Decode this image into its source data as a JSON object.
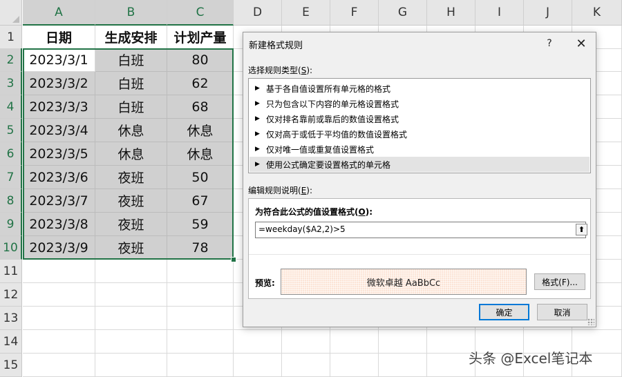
{
  "columns": [
    "A",
    "B",
    "C",
    "D",
    "E",
    "F",
    "G",
    "H",
    "I",
    "J",
    "K"
  ],
  "rows": [
    "1",
    "2",
    "3",
    "4",
    "5",
    "6",
    "7",
    "8",
    "9",
    "10",
    "11",
    "12",
    "13",
    "14",
    "15"
  ],
  "table": {
    "headers": [
      "日期",
      "生成安排",
      "计划产量"
    ],
    "data": [
      [
        "2023/3/1",
        "白班",
        "80"
      ],
      [
        "2023/3/2",
        "白班",
        "62"
      ],
      [
        "2023/3/3",
        "白班",
        "68"
      ],
      [
        "2023/3/4",
        "休息",
        "休息"
      ],
      [
        "2023/3/5",
        "休息",
        "休息"
      ],
      [
        "2023/3/6",
        "夜班",
        "50"
      ],
      [
        "2023/3/7",
        "夜班",
        "67"
      ],
      [
        "2023/3/8",
        "夜班",
        "59"
      ],
      [
        "2023/3/9",
        "夜班",
        "78"
      ]
    ]
  },
  "dialog": {
    "title": "新建格式规则",
    "help": "?",
    "close": "✕",
    "rule_type_label": "选择规则类型(",
    "rule_type_key": "S",
    "rule_type_label_end": "):",
    "rule_types": [
      "基于各自值设置所有单元格的格式",
      "只为包含以下内容的单元格设置格式",
      "仅对排名靠前或靠后的数值设置格式",
      "仅对高于或低于平均值的数值设置格式",
      "仅对唯一值或重复值设置格式",
      "使用公式确定要设置格式的单元格"
    ],
    "selected_rule_index": 5,
    "edit_label": "编辑规则说明(",
    "edit_key": "E",
    "edit_label_end": "):",
    "formula_label": "为符合此公式的值设置格式(",
    "formula_key": "O",
    "formula_label_end": "):",
    "formula_value": "=weekday($A2,2)>5",
    "preview_label": "预览:",
    "preview_text": "微软卓越  AaBbCc",
    "format_button": "格式(F)...",
    "ok_button": "确定",
    "cancel_button": "取消"
  },
  "watermark": "头条 @Excel笔记本",
  "colors": {
    "accent": "#217346",
    "shaded_cell": "#d0d0d0",
    "preview_fill": "#fce4d6",
    "primary_button_border": "#0078d7"
  }
}
